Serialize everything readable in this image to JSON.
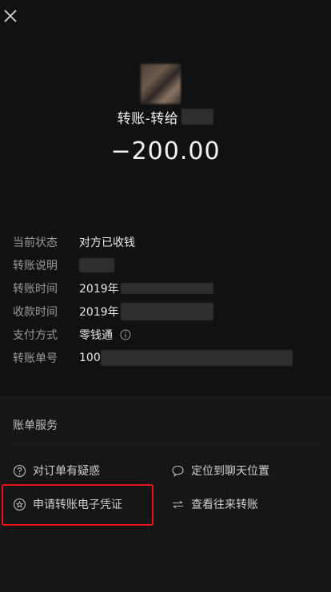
{
  "header": {
    "title": "转账-转给",
    "amount": "−200.00"
  },
  "details": [
    {
      "label": "当前状态",
      "value": "对方已收钱"
    },
    {
      "label": "转账说明",
      "value": ""
    },
    {
      "label": "转账时间",
      "value": "2019年"
    },
    {
      "label": "收款时间",
      "value": "2019年"
    },
    {
      "label": "支付方式",
      "value": "零钱通"
    },
    {
      "label": "转账单号",
      "value": "100"
    }
  ],
  "services": {
    "title": "账单服务",
    "items": [
      {
        "label": "对订单有疑惑",
        "icon": "question-circle-icon"
      },
      {
        "label": "定位到聊天位置",
        "icon": "chat-bubble-icon"
      },
      {
        "label": "申请转账电子凭证",
        "icon": "star-circle-icon"
      },
      {
        "label": "查看往来转账",
        "icon": "swap-arrows-icon"
      }
    ]
  },
  "colors": {
    "background": "#111111",
    "highlight": "#e8141a"
  }
}
